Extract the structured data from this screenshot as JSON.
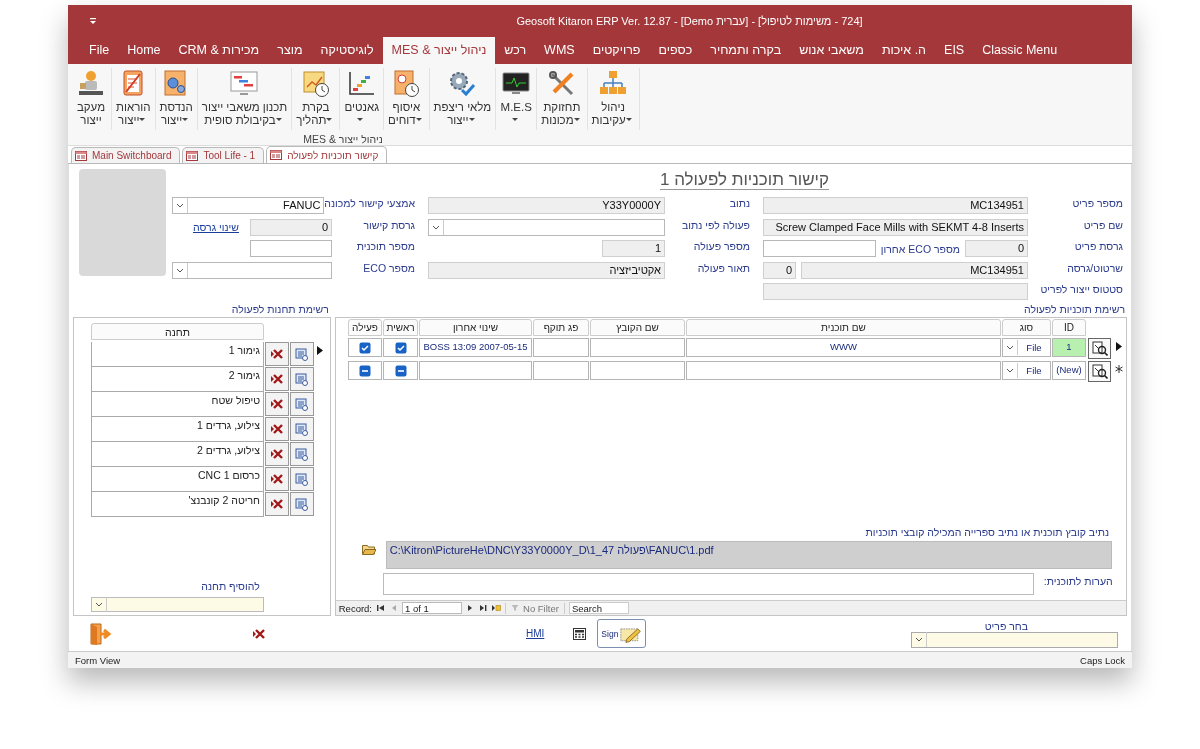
{
  "window": {
    "title": "Geosoft Kitaron ERP Ver. 12.87 - [Demo עברית] - [724 - משימות לטיפול]"
  },
  "ribbon_tabs": [
    {
      "label": "Classic Menu",
      "selected": false
    },
    {
      "label": "EIS",
      "selected": false
    },
    {
      "label": "ה. איכות",
      "selected": false
    },
    {
      "label": "משאבי אנוש",
      "selected": false
    },
    {
      "label": "בקרה ותמחיר",
      "selected": false
    },
    {
      "label": "כספים",
      "selected": false
    },
    {
      "label": "פרויקטים",
      "selected": false
    },
    {
      "label": "WMS",
      "selected": false
    },
    {
      "label": "רכש",
      "selected": false
    },
    {
      "label": "ניהול ייצור & MES",
      "selected": true
    },
    {
      "label": "לוגיסטיקה",
      "selected": false
    },
    {
      "label": "מוצר",
      "selected": false
    },
    {
      "label": "מכירות & CRM",
      "selected": false
    },
    {
      "label": "Home",
      "selected": false
    },
    {
      "label": "File",
      "selected": false
    }
  ],
  "ribbon": {
    "group": "ניהול ייצור & MES",
    "buttons": [
      {
        "lines": [
          "ניהול",
          "עקיבות"
        ],
        "dropdown": true
      },
      {
        "lines": [
          "תחזוקת",
          "מכונות"
        ],
        "dropdown": true
      },
      {
        "lines": [
          "M.E.S"
        ],
        "dropdown": true
      },
      {
        "lines": [
          "מלאי ריצפת",
          "ייצור"
        ],
        "dropdown": true
      },
      {
        "lines": [
          "איסוף",
          "דוחים"
        ],
        "dropdown": true
      },
      {
        "lines": [
          "גאנטים"
        ],
        "dropdown": true
      },
      {
        "lines": [
          "בקרת",
          "תהליך"
        ],
        "dropdown": true
      },
      {
        "lines": [
          "תכנון משאבי ייצור",
          "בקיבולת סופית"
        ],
        "dropdown": true
      },
      {
        "lines": [
          "הנדסת",
          "ייצור"
        ],
        "dropdown": true
      },
      {
        "lines": [
          "הוראות",
          "ייצור"
        ],
        "dropdown": true
      },
      {
        "lines": [
          "מעקב",
          "ייצור"
        ],
        "dropdown": false
      }
    ]
  },
  "document_tabs": [
    {
      "label": "קישור תוכניות לפעולה",
      "selected": true
    },
    {
      "label": "Tool Life - 1",
      "selected": false
    },
    {
      "label": "Main Switchboard",
      "selected": false
    }
  ],
  "form": {
    "title": "קישור תוכניות לפעולה 1",
    "columns": [
      {
        "rows": [
          [
            {
              "label": "מספר פריט",
              "value": "MC134951",
              "kind": "text",
              "readonly": true
            }
          ],
          [
            {
              "label": "שם פריט",
              "value": "Screw Clamped Face Mills with SEKMT 4-8 Inserts",
              "kind": "text",
              "readonly": true
            }
          ],
          [
            {
              "label": "גרסת פריט",
              "value": "0",
              "kind": "short",
              "readonly": true
            },
            {
              "label": "מספר ECO אחרון",
              "kind": "text",
              "readonly": false
            }
          ],
          [
            {
              "label": "שרטוט/גרסה",
              "value": "MC134951",
              "kind": "text",
              "readonly": true
            },
            {
              "value": "0",
              "kind": "tiny",
              "readonly": true
            }
          ],
          [
            {
              "label": "סטטוס ייצור לפריט",
              "kind": "text",
              "readonly": true
            }
          ]
        ]
      },
      {
        "rows": [
          [
            {
              "label": "נתוב",
              "value": "Y33Y0000Y",
              "kind": "text",
              "readonly": true
            }
          ],
          [
            {
              "label": "פעולה לפי נתוב",
              "kind": "combo"
            }
          ],
          [
            {
              "label": "מספר פעולה",
              "value": "1",
              "kind": "short",
              "readonly": true
            }
          ],
          [
            {
              "label": "תאור פעולה",
              "value": "אקטיביזציה",
              "kind": "text",
              "readonly": true
            }
          ]
        ]
      },
      {
        "rows": [
          [
            {
              "label": "אמצעי קישור למכונה",
              "value": "FANUC",
              "kind": "combo"
            }
          ],
          [
            {
              "label": "גרסת קישור",
              "value": "0",
              "kind": "short",
              "readonly": true
            },
            {
              "value": "שינוי גרסה",
              "kind": "link"
            }
          ],
          [
            {
              "label": "מספר תוכנית",
              "kind": "short",
              "readonly": false
            }
          ],
          [
            {
              "label": "מספר ECO",
              "kind": "combo"
            }
          ]
        ]
      }
    ]
  },
  "stations": {
    "label": "רשימת תחנות לפעולה",
    "column": "תחנה",
    "add_label": "להוסיף תחנה",
    "rows": [
      {
        "name": "גימור 1",
        "selected": true
      },
      {
        "name": "גימור 2",
        "selected": false
      },
      {
        "name": "טיפול שטח",
        "selected": false
      },
      {
        "name": "צילוע, גרדים 1",
        "selected": false
      },
      {
        "name": "צילוע, גרדים 2",
        "selected": false
      },
      {
        "name": "כרסום CNC 1",
        "selected": false
      },
      {
        "name": "חריטה 2 קונבנצ'",
        "selected": false
      }
    ]
  },
  "programs": {
    "label": "רשימת תוכניות לפעולה",
    "columns": [
      "ID",
      "סוג",
      "שם תוכנית",
      "שם הקובץ",
      "פג תוקף",
      "שינוי אחרון",
      "ראשית",
      "פעילה"
    ],
    "rows": [
      {
        "kind": "record",
        "selected": true,
        "id": "1",
        "type": "File",
        "name": "WWW",
        "last_change": "2007-05-15 13:09 BOSS",
        "main": true,
        "active": true
      },
      {
        "kind": "new",
        "selected": false,
        "id": "(New)",
        "type": "File",
        "main": false,
        "active": false
      }
    ],
    "path_label": "נתיב קובץ תוכנית או נתיב ספרייה המכילה קובצי תוכניות",
    "path": "C:\\Kitron\\PictureHe\\DNC\\Y33Y0000Y_D\\פעולה 47_1\\FANUC\\1.pdf",
    "notes_label": "הערות לתוכנית:"
  },
  "navigator": {
    "label": "Record:",
    "position": "1 of 1",
    "filter": "No Filter",
    "search": "Search"
  },
  "footer": {
    "link": "HMI",
    "sign": "Sign",
    "picker_label": "בחר פריט"
  },
  "status_bar": {
    "left": "Form View",
    "right": "Caps Lock"
  }
}
